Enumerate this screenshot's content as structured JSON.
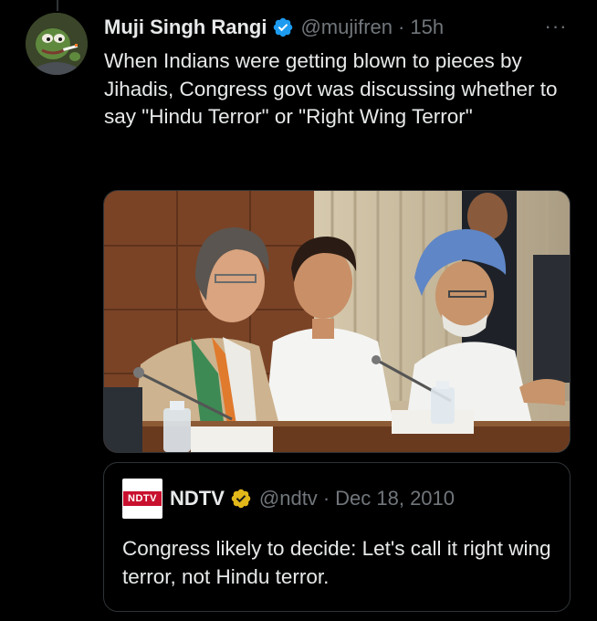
{
  "tweet": {
    "author": {
      "display_name": "Muji Singh Rangi",
      "handle": "@mujifren",
      "verified": true,
      "verified_color": "#1d9bf0"
    },
    "separator": "·",
    "time": "15h",
    "more_icon": "more-horizontal-icon",
    "more_glyph": "···",
    "text": "When Indians were getting blown to pieces by Jihadis, Congress govt was discussing whether to say \"Hindu Terror\" or \"Right Wing Terror\"",
    "media": {
      "type": "photo"
    }
  },
  "quoted_tweet": {
    "author": {
      "display_name": "NDTV",
      "handle": "@ndtv",
      "verified": true,
      "verified_color": "#e2b719",
      "avatar_text": "NDTV"
    },
    "separator": "·",
    "date": "Dec 18, 2010",
    "text": "Congress likely to decide: Let's call it right wing terror, not Hindu terror."
  },
  "colors": {
    "background": "#000000",
    "primary_text": "#e7e9ea",
    "secondary_text": "#71767b",
    "border": "#2f3336",
    "brand_red": "#c8102e"
  }
}
